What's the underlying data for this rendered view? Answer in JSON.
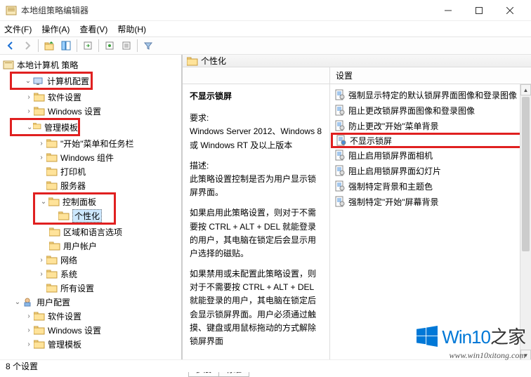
{
  "window": {
    "title": "本地组策略编辑器"
  },
  "menu": {
    "file": "文件(F)",
    "action": "操作(A)",
    "view": "查看(V)",
    "help": "帮助(H)"
  },
  "tree": {
    "root": "本地计算机 策略",
    "computerConfig": "计算机配置",
    "softwareSettings": "软件设置",
    "windowsSettings": "Windows 设置",
    "adminTemplates": "管理模板",
    "startMenu": "\"开始\"菜单和任务栏",
    "winComponents": "Windows 组件",
    "printers": "打印机",
    "servers": "服务器",
    "controlPanel": "控制面板",
    "personalization": "个性化",
    "regionLang": "区域和语言选项",
    "userAccounts": "用户帐户",
    "network": "网络",
    "system": "系统",
    "allSettings": "所有设置",
    "userConfig": "用户配置",
    "userSoftwareSettings": "软件设置",
    "userWindowsSettings": "Windows 设置",
    "userAdminTemplates": "管理模板"
  },
  "header": {
    "icon": "folder",
    "title": "个性化"
  },
  "detail": {
    "title": "不显示锁屏",
    "reqLabel": "要求:",
    "req": "Windows Server 2012、Windows 8 或 Windows RT 及以上版本",
    "descLabel": "描述:",
    "desc": "此策略设置控制是否为用户显示锁屏界面。",
    "p1": "如果启用此策略设置，则对于不需要按 CTRL + ALT + DEL  就能登录的用户，其电脑在锁定后会显示用户选择的磁贴。",
    "p2": "如果禁用或未配置此策略设置，则对于不需要按 CTRL + ALT + DEL 就能登录的用户，其电脑在锁定后会显示锁屏界面。用户必须通过触摸、键盘或用鼠标拖动的方式解除锁屏界面"
  },
  "listHeader": "设置",
  "items": [
    "强制显示特定的默认锁屏界面图像和登录图像",
    "阻止更改锁屏界面图像和登录图像",
    "防止更改\"开始\"菜单背景",
    "不显示锁屏",
    "阻止启用锁屏界面相机",
    "阻止启用锁屏界面幻灯片",
    "强制特定背景和主题色",
    "强制特定\"开始\"屏幕背景"
  ],
  "selectedIndex": 3,
  "tabs": {
    "extended": "扩展",
    "standard": "标准"
  },
  "status": "8 个设置",
  "watermark": {
    "brand": "Win10",
    "suffix": "之家",
    "url": "www.win10xitong.com"
  }
}
